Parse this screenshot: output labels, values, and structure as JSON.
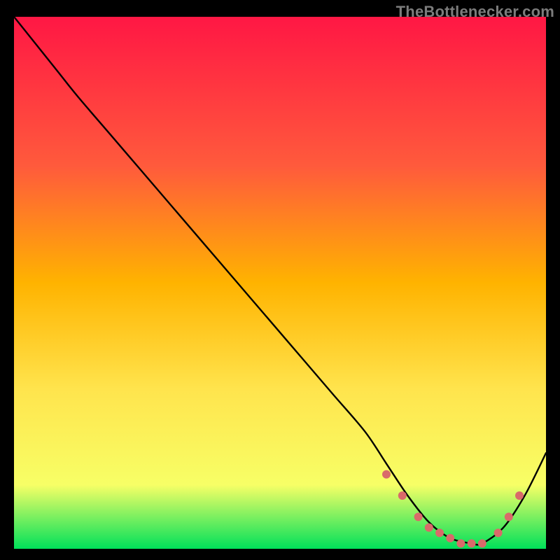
{
  "watermark": "TheBottlenecker.com",
  "colors": {
    "gradient_top": "#ff1744",
    "gradient_mid1": "#ff5a3c",
    "gradient_mid2": "#ffb300",
    "gradient_mid3": "#ffe44d",
    "gradient_mid4": "#f7ff66",
    "gradient_bottom": "#00e05a",
    "line": "#000000",
    "dot": "#d96a6a",
    "frame": "#000000"
  },
  "chart_data": {
    "type": "line",
    "title": "",
    "xlabel": "",
    "ylabel": "",
    "xlim": [
      0,
      100
    ],
    "ylim": [
      0,
      100
    ],
    "x": [
      0,
      8,
      12,
      18,
      24,
      30,
      36,
      42,
      48,
      54,
      60,
      66,
      70,
      74,
      78,
      82,
      86,
      88,
      92,
      96,
      100
    ],
    "y": [
      100,
      90,
      85,
      78,
      71,
      64,
      57,
      50,
      43,
      36,
      29,
      22,
      16,
      10,
      5,
      2,
      1,
      1,
      4,
      10,
      18
    ],
    "dots_x": [
      70,
      73,
      76,
      78,
      80,
      82,
      84,
      86,
      88,
      91,
      93,
      95
    ],
    "dots_y": [
      14,
      10,
      6,
      4,
      3,
      2,
      1,
      1,
      1,
      3,
      6,
      10
    ]
  }
}
